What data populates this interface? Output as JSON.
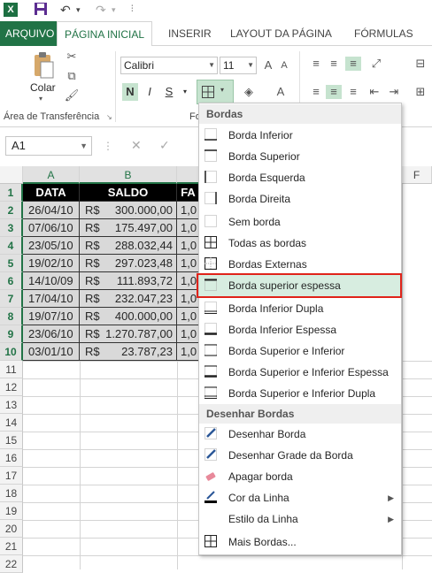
{
  "app": {
    "logo": "X"
  },
  "tabs": [
    {
      "label": "ARQUIVO"
    },
    {
      "label": "PÁGINA INICIAL"
    },
    {
      "label": "INSERIR"
    },
    {
      "label": "LAYOUT DA PÁGINA"
    },
    {
      "label": "FÓRMULAS"
    }
  ],
  "ribbon": {
    "paste_label": "Colar",
    "clipboard_group": "Área de Transferência",
    "font_group_partial": "Fo",
    "font_name": "Calibri",
    "font_size": "11",
    "bold": "N",
    "italic": "I",
    "underline": "S"
  },
  "formula_bar": {
    "name_box": "A1"
  },
  "columns": [
    "A",
    "B",
    "F"
  ],
  "column_partial": "F",
  "rows": [
    "1",
    "2",
    "3",
    "4",
    "5",
    "6",
    "7",
    "8",
    "9",
    "10",
    "11",
    "12",
    "13",
    "14",
    "15",
    "16",
    "17",
    "18",
    "19",
    "20",
    "21",
    "22"
  ],
  "table": {
    "headers": [
      "DATA",
      "SALDO",
      "FA"
    ],
    "currency": "R$",
    "rows": [
      {
        "date": "26/04/10",
        "value": "300.000,00",
        "c": "1,0"
      },
      {
        "date": "07/06/10",
        "value": "175.497,00",
        "c": "1,0"
      },
      {
        "date": "23/05/10",
        "value": "288.032,44",
        "c": "1,0"
      },
      {
        "date": "19/02/10",
        "value": "297.023,48",
        "c": "1,0"
      },
      {
        "date": "14/10/09",
        "value": "111.893,72",
        "c": "1,0"
      },
      {
        "date": "17/04/10",
        "value": "232.047,23",
        "c": "1,0"
      },
      {
        "date": "19/07/10",
        "value": "400.000,00",
        "c": "1,0"
      },
      {
        "date": "23/06/10",
        "value": "1.270.787,00",
        "c": "1,0"
      },
      {
        "date": "03/01/10",
        "value": "23.787,23",
        "c": "1,0"
      }
    ]
  },
  "menu": {
    "section_borders": "Bordas",
    "section_draw": "Desenhar Bordas",
    "items": [
      {
        "label": "Borda Inferior",
        "icon": "bottom-border-icon"
      },
      {
        "label": "Borda Superior",
        "icon": "top-border-icon"
      },
      {
        "label": "Borda Esquerda",
        "icon": "left-border-icon"
      },
      {
        "label": "Borda Direita",
        "icon": "right-border-icon"
      },
      {
        "label": "Sem borda",
        "icon": "no-border-icon"
      },
      {
        "label": "Todas as bordas",
        "icon": "all-borders-icon"
      },
      {
        "label": "Bordas Externas",
        "icon": "outside-borders-icon"
      },
      {
        "label": "Borda superior espessa",
        "icon": "thick-top-border-icon"
      },
      {
        "label": "Borda Inferior Dupla",
        "icon": "bottom-double-border-icon"
      },
      {
        "label": "Borda Inferior Espessa",
        "icon": "thick-bottom-border-icon"
      },
      {
        "label": "Borda Superior e Inferior",
        "icon": "top-bottom-border-icon"
      },
      {
        "label": "Borda Superior e Inferior Espessa",
        "icon": "top-thick-bottom-border-icon"
      },
      {
        "label": "Borda Superior e Inferior Dupla",
        "icon": "top-double-bottom-border-icon"
      }
    ],
    "draw_items": [
      {
        "label": "Desenhar Borda",
        "icon": "draw-border-icon"
      },
      {
        "label": "Desenhar Grade da Borda",
        "icon": "draw-border-grid-icon"
      },
      {
        "label": "Apagar borda",
        "icon": "eraser-icon"
      },
      {
        "label": "Cor da Linha",
        "icon": "line-color-icon"
      },
      {
        "label": "Estilo da Linha",
        "icon": "line-style-icon"
      },
      {
        "label": "Mais Bordas...",
        "icon": "more-borders-icon"
      }
    ]
  },
  "colors": {
    "accent": "#217346",
    "highlight": "#d7ede0",
    "annotation": "#e0231a"
  }
}
